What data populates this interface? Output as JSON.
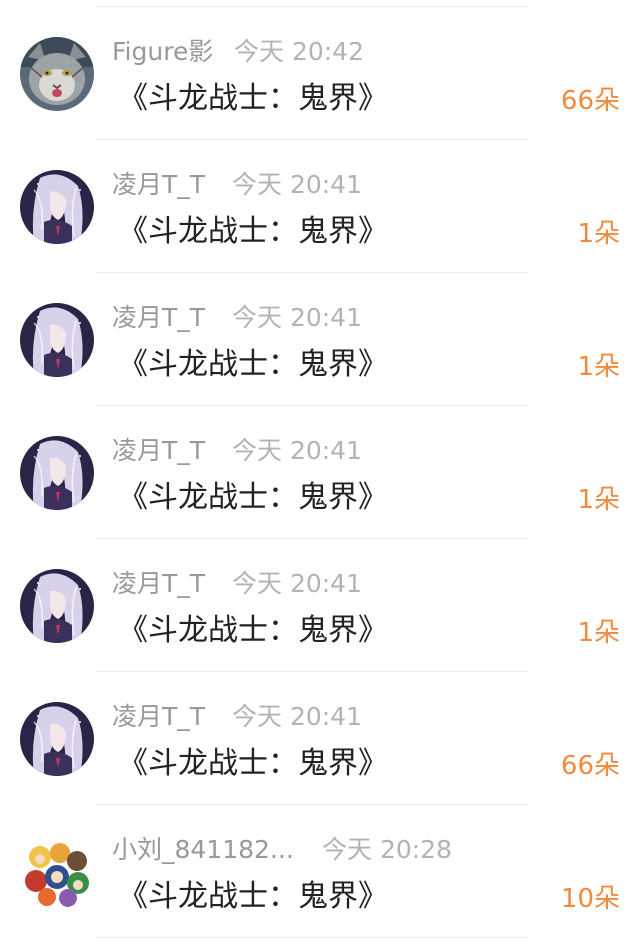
{
  "entries": [
    {
      "username": "Figure影",
      "time": "今天 20:42",
      "gift": "《斗龙战士：鬼界》",
      "count": "66朵",
      "avatar_icon": "cat-avatar"
    },
    {
      "username": "凌月T_T",
      "time": "今天 20:41",
      "gift": "《斗龙战士：鬼界》",
      "count": "1朵",
      "avatar_icon": "anime-girl-avatar"
    },
    {
      "username": "凌月T_T",
      "time": "今天 20:41",
      "gift": "《斗龙战士：鬼界》",
      "count": "1朵",
      "avatar_icon": "anime-girl-avatar"
    },
    {
      "username": "凌月T_T",
      "time": "今天 20:41",
      "gift": "《斗龙战士：鬼界》",
      "count": "1朵",
      "avatar_icon": "anime-girl-avatar"
    },
    {
      "username": "凌月T_T",
      "time": "今天 20:41",
      "gift": "《斗龙战士：鬼界》",
      "count": "1朵",
      "avatar_icon": "anime-girl-avatar"
    },
    {
      "username": "凌月T_T",
      "time": "今天 20:41",
      "gift": "《斗龙战士：鬼界》",
      "count": "66朵",
      "avatar_icon": "anime-girl-avatar"
    },
    {
      "username": "小刘_841182...",
      "time": "今天 20:28",
      "gift": "《斗龙战士：鬼界》",
      "count": "10朵",
      "avatar_icon": "cartoon-group-avatar"
    }
  ],
  "colors": {
    "count": "#f08a3c",
    "gift_text": "#222222",
    "meta_text": "#9a9a9a",
    "divider": "#ececec"
  }
}
